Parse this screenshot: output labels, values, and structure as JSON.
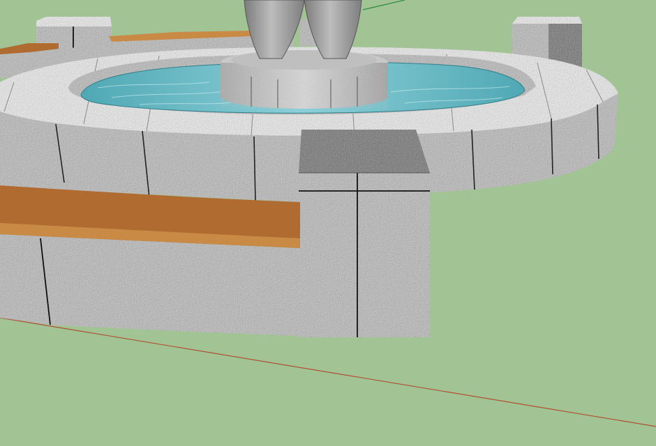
{
  "app": {
    "window_title": "",
    "view": "3d-model-viewport"
  },
  "scene": {
    "background_color": "#a2c495",
    "ground_color": "#a2c495",
    "granite_light": "#e6e6e6",
    "granite_mid": "#b4b4b4",
    "granite_dark": "#6e6e6e",
    "wood_top": "#b06b30",
    "wood_front": "#c98a45",
    "water_color": "#4fa8b4",
    "water_highlight": "#8ccfd8",
    "statue_color": "#9a9a9a",
    "axis_red": "#b05030",
    "axis_green": "#2c8a3c",
    "edge_color": "#111111",
    "components": [
      "fountain-outer-wall",
      "fountain-cap-ring",
      "water-pool",
      "center-pedestal",
      "statue",
      "granite-pillar-left",
      "granite-pillar-right",
      "granite-pillar-center",
      "wooden-bench-front",
      "wooden-bench-back",
      "seating-wall-front"
    ]
  }
}
